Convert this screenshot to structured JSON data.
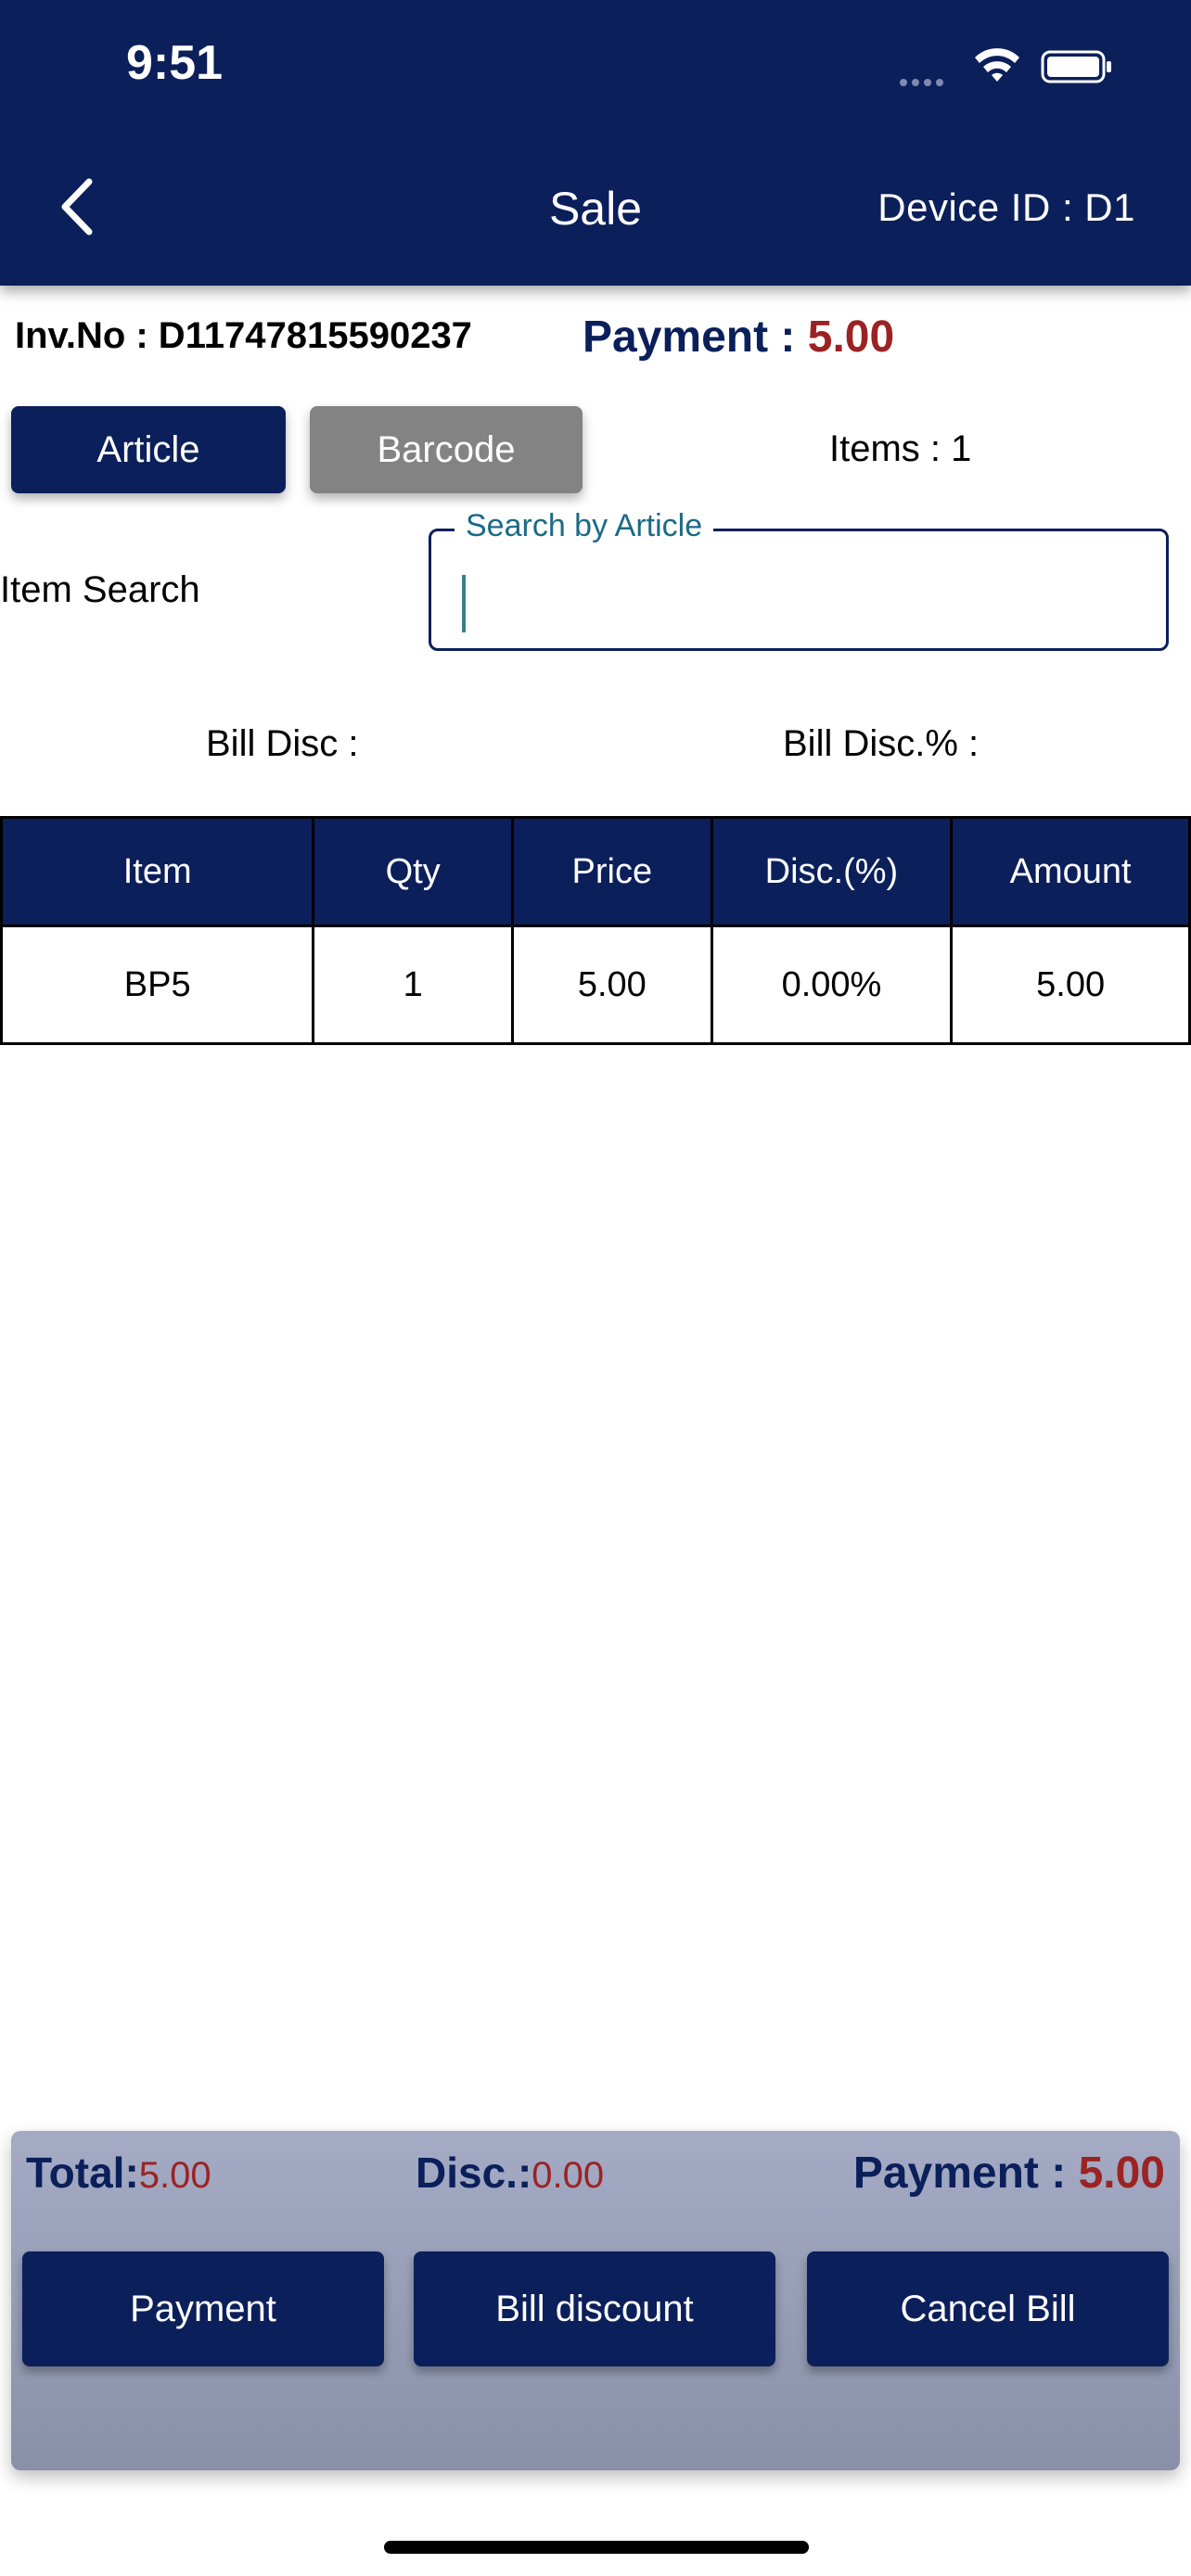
{
  "status_bar": {
    "time": "9:51"
  },
  "header": {
    "title": "Sale",
    "device_id": "Device ID : D1",
    "back_icon": "chevron-left-icon"
  },
  "invoice": {
    "inv_no": "Inv.No : D11747815590237",
    "payment_label": "Payment : ",
    "payment_value": "5.00"
  },
  "mode_buttons": {
    "article": "Article",
    "barcode": "Barcode"
  },
  "items_count": "Items : 1",
  "search": {
    "label": "Item Search",
    "legend": "Search by Article",
    "value": ""
  },
  "bill_disc": {
    "label": "Bill Disc :",
    "pct_label": "Bill Disc.% :"
  },
  "table": {
    "columns": [
      "Item",
      "Qty",
      "Price",
      "Disc.(%)",
      "Amount"
    ],
    "rows": [
      [
        "BP5",
        "1",
        "5.00",
        "0.00%",
        "5.00"
      ]
    ]
  },
  "footer": {
    "total_label": "Total:",
    "total_value": "5.00",
    "disc_label": "Disc.:",
    "disc_value": "0.00",
    "payment_label": "Payment : ",
    "payment_value": "5.00",
    "buttons": {
      "payment": "Payment",
      "bill_discount": "Bill discount",
      "cancel_bill": "Cancel Bill"
    }
  },
  "colors": {
    "primary": "#0b1f5b",
    "accent_red": "#9b2323",
    "barcode_gray": "#838383"
  }
}
